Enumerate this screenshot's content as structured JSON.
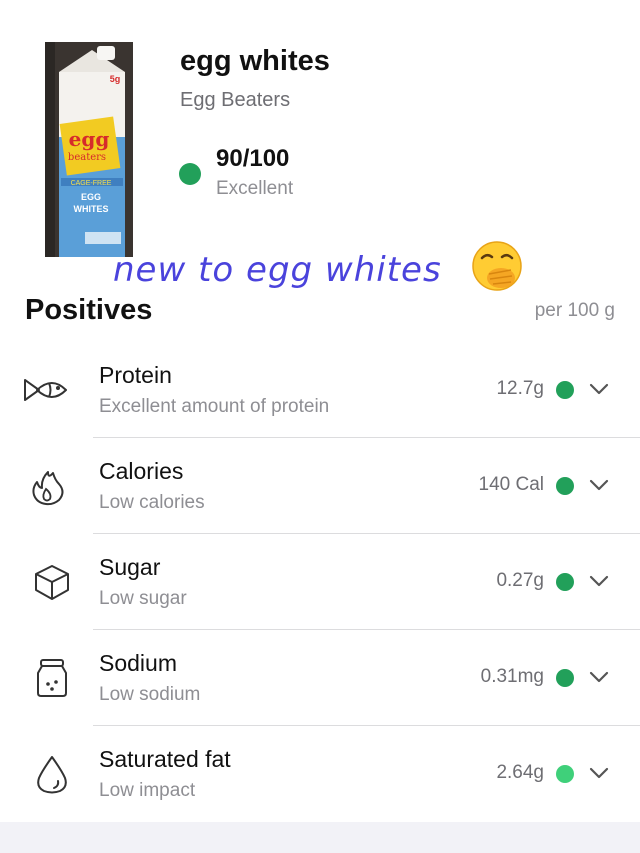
{
  "product": {
    "name": "egg whites",
    "brand": "Egg Beaters",
    "image_icon": "egg-beaters-carton-photo",
    "score": {
      "value": "90/100",
      "label": "Excellent",
      "color": "#22a05a"
    }
  },
  "overlay": {
    "caption": "new to egg whites",
    "caption_color": "#4a43dc",
    "emoji_icon": "face-with-hand-over-mouth-emoji"
  },
  "section": {
    "title": "Positives",
    "per_unit": "per 100 g"
  },
  "nutrients": [
    {
      "icon": "fish-icon",
      "label": "Protein",
      "sub": "Excellent amount of protein",
      "value": "12.7g",
      "dot_color": "#22a05a"
    },
    {
      "icon": "flame-icon",
      "label": "Calories",
      "sub": "Low calories",
      "value": "140 Cal",
      "dot_color": "#22a05a"
    },
    {
      "icon": "cube-icon",
      "label": "Sugar",
      "sub": "Low sugar",
      "value": "0.27g",
      "dot_color": "#22a05a"
    },
    {
      "icon": "salt-shaker-icon",
      "label": "Sodium",
      "sub": "Low sodium",
      "value": "0.31mg",
      "dot_color": "#22a05a"
    },
    {
      "icon": "drop-icon",
      "label": "Saturated fat",
      "sub": "Low impact",
      "value": "2.64g",
      "dot_color": "#3fd07a"
    }
  ]
}
